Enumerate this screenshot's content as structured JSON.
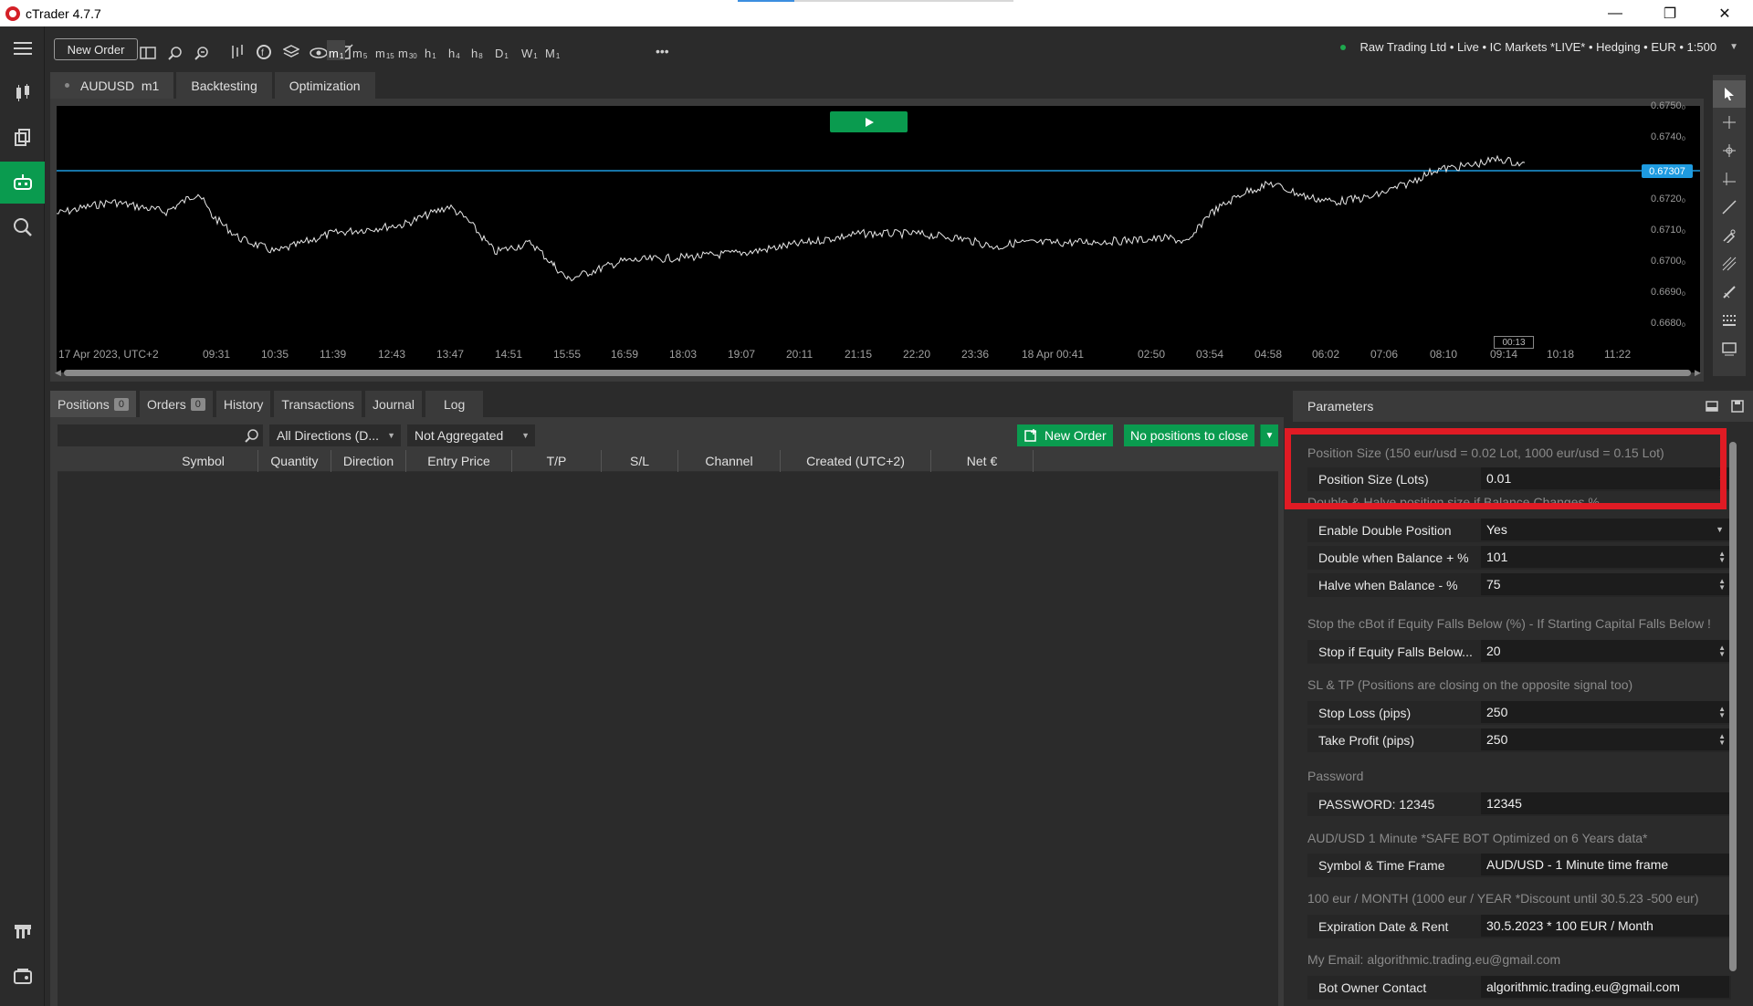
{
  "app": {
    "title": "cTrader 4.7.7"
  },
  "toolbar": {
    "new_order_label": "New Order",
    "timeframes": [
      {
        "main": "m",
        "sub": "1"
      },
      {
        "main": "m",
        "sub": "5"
      },
      {
        "main": "m",
        "sub": "15"
      },
      {
        "main": "m",
        "sub": "30"
      },
      {
        "main": "h",
        "sub": "1"
      },
      {
        "main": "h",
        "sub": "4"
      },
      {
        "main": "h",
        "sub": "8"
      },
      {
        "main": "D",
        "sub": "1"
      },
      {
        "main": "W",
        "sub": "1"
      },
      {
        "main": "M",
        "sub": "1"
      }
    ],
    "more_label": "•••",
    "account_info": "Raw Trading Ltd • Live • IC Markets *LIVE* • Hedging • EUR • 1:500"
  },
  "chart_tabs": [
    {
      "label": "AUDUSD  m1"
    },
    {
      "label": "Backtesting"
    },
    {
      "label": "Optimization"
    }
  ],
  "chart": {
    "current_price": "0.67307",
    "price_labels": [
      "0.6750₀",
      "0.6740₀",
      "0.6720₀",
      "0.6710₀",
      "0.6700₀",
      "0.6690₀",
      "0.6680₀"
    ],
    "time_labels": [
      "17 Apr 2023, UTC+2",
      "09:31",
      "10:35",
      "11:39",
      "12:43",
      "13:47",
      "14:51",
      "15:55",
      "16:59",
      "18:03",
      "19:07",
      "20:11",
      "21:15",
      "22:20",
      "23:36",
      "18 Apr 00:41",
      "02:50",
      "03:54",
      "04:58",
      "06:02",
      "07:06",
      "08:10",
      "09:14",
      "10:18",
      "11:22"
    ],
    "countdown": "00:13"
  },
  "bottom_tabs": [
    {
      "label": "Positions",
      "count": "0"
    },
    {
      "label": "Orders",
      "count": "0"
    },
    {
      "label": "History"
    },
    {
      "label": "Transactions"
    },
    {
      "label": "Journal"
    },
    {
      "label": "Log"
    }
  ],
  "positions": {
    "direction_filter": "All Directions (D...",
    "aggregation": "Not Aggregated",
    "new_order_label": "New Order",
    "close_label": "No positions to close",
    "columns": [
      "Symbol",
      "Quantity",
      "Direction",
      "Entry Price",
      "T/P",
      "S/L",
      "Channel",
      "Created (UTC+2)",
      "Net €"
    ]
  },
  "parameters": {
    "title": "Parameters",
    "groups": [
      "Position Size (150 eur/usd = 0.02 Lot, 1000 eur/usd = 0.15 Lot)",
      "Double & Halve position size if Balance Changes %",
      "Stop the cBot if Equity Falls Below (%) - If Starting Capital Falls Below !",
      "SL & TP (Positions are closing on the opposite signal too)",
      "Password",
      "AUD/USD  1 Minute  *SAFE  BOT Optimized on 6 Years data*",
      "100 eur / MONTH (1000 eur / YEAR *Discount until 30.5.23 -500 eur)",
      "My Email:   algorithmic.trading.eu@gmail.com"
    ],
    "rows": [
      {
        "name": "Position Size (Lots)",
        "value": "0.01",
        "kind": "spin"
      },
      {
        "name": "Enable Double Position",
        "value": "Yes",
        "kind": "select"
      },
      {
        "name": "Double when Balance  + %",
        "value": "101",
        "kind": "spin"
      },
      {
        "name": "Halve when Balance  - %",
        "value": "75",
        "kind": "spin"
      },
      {
        "name": "Stop if Equity Falls Below...",
        "value": "20",
        "kind": "spin"
      },
      {
        "name": "Stop Loss  (pips)",
        "value": "250",
        "kind": "spin"
      },
      {
        "name": "Take Profit  (pips)",
        "value": "250",
        "kind": "spin"
      },
      {
        "name": "PASSWORD: 12345",
        "value": "12345",
        "kind": "text"
      },
      {
        "name": "Symbol & Time Frame",
        "value": "AUD/USD  - 1 Minute time frame",
        "kind": "text"
      },
      {
        "name": "Expiration Date & Rent",
        "value": "30.5.2023 * 100 EUR / Month",
        "kind": "text"
      },
      {
        "name": "Bot Owner Contact",
        "value": "algorithmic.trading.eu@gmail.com",
        "kind": "text"
      }
    ]
  },
  "colors": {
    "accent_green": "#0a9b4f",
    "price_line": "#1e9be0",
    "highlight_red": "#e01b24"
  }
}
